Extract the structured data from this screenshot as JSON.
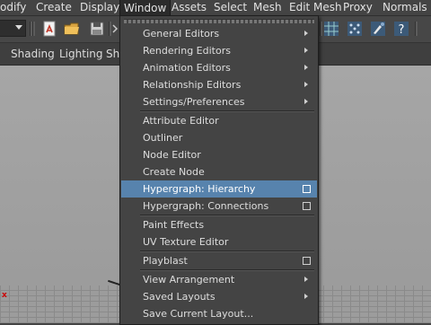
{
  "menubar": {
    "items": [
      "odify",
      "Create",
      "Display",
      "Window",
      "Assets",
      "Select",
      "Mesh",
      "Edit Mesh",
      "Proxy",
      "Normals"
    ]
  },
  "panel_menu": {
    "items": [
      "Shading",
      "Lighting",
      "Sho"
    ]
  },
  "viewport": {
    "axis_label": "x"
  },
  "window_menu": {
    "sections": [
      [
        {
          "label": "General Editors",
          "submenu": true
        },
        {
          "label": "Rendering Editors",
          "submenu": true
        },
        {
          "label": "Animation Editors",
          "submenu": true
        },
        {
          "label": "Relationship Editors",
          "submenu": true
        },
        {
          "label": "Settings/Preferences",
          "submenu": true
        }
      ],
      [
        {
          "label": "Attribute Editor"
        },
        {
          "label": "Outliner"
        },
        {
          "label": "Node Editor"
        },
        {
          "label": "Create Node"
        },
        {
          "label": "Hypergraph: Hierarchy",
          "option_box": true,
          "highlighted": true
        },
        {
          "label": "Hypergraph: Connections",
          "option_box": true
        }
      ],
      [
        {
          "label": "Paint Effects"
        },
        {
          "label": "UV Texture Editor"
        }
      ],
      [
        {
          "label": "Playblast",
          "option_box": true
        }
      ],
      [
        {
          "label": "View Arrangement",
          "submenu": true
        },
        {
          "label": "Saved Layouts",
          "submenu": true
        },
        {
          "label": "Save Current Layout..."
        }
      ]
    ]
  },
  "colors": {
    "highlight": "#5783ad",
    "menu_bg": "#444444",
    "viewport_bg": "#a3a3a3"
  },
  "toolbar_icons": [
    "scene-open-icon",
    "folder-icon",
    "save-icon",
    "snap-grid-icon",
    "snap-points-icon",
    "paint-icon",
    "help-icon"
  ]
}
